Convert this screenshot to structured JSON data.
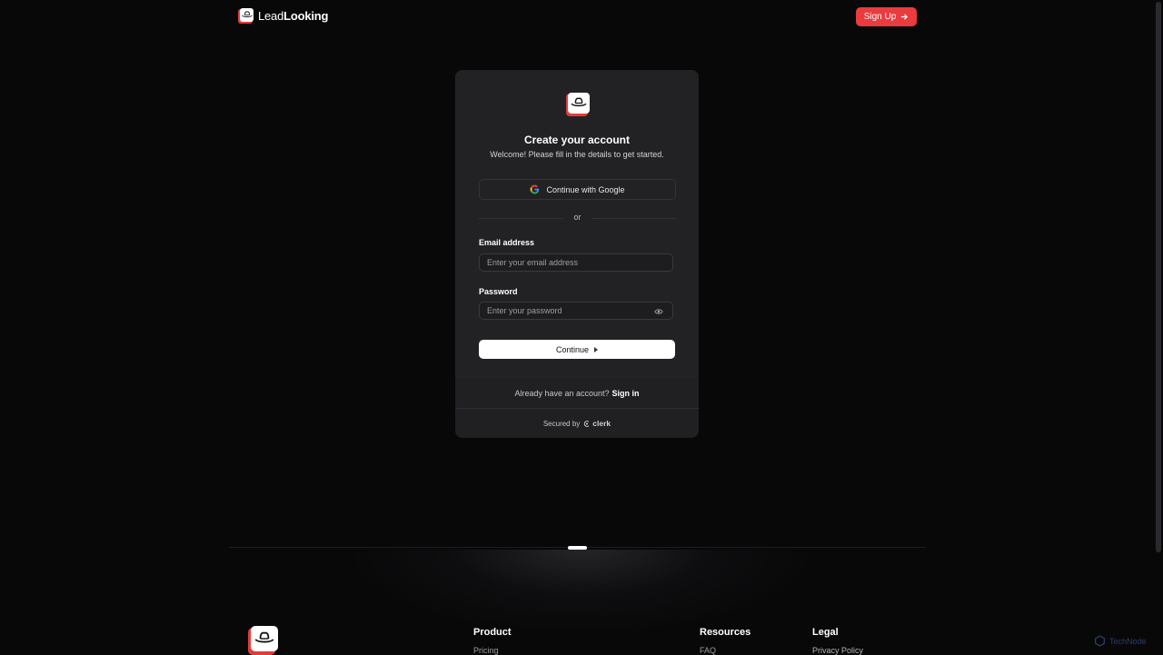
{
  "header": {
    "brand_light": "Lead",
    "brand_bold": "Looking",
    "signup_label": "Sign Up",
    "signup_icon": "arrow-right-icon",
    "accent_color": "#ea3b3e"
  },
  "auth_card": {
    "title": "Create your account",
    "subtitle": "Welcome! Please fill in the details to get started.",
    "google_label": "Continue with Google",
    "divider_text": "or",
    "email_label": "Email address",
    "email_placeholder": "Enter your email address",
    "password_label": "Password",
    "password_placeholder": "Enter your password",
    "continue_label": "Continue",
    "have_account_text": "Already have an account?",
    "signin_label": "Sign in",
    "secured_by_text": "Secured by",
    "clerk_label": "clerk"
  },
  "footer": {
    "columns": [
      {
        "title": "Product",
        "link": "Pricing"
      },
      {
        "title": "Resources",
        "link": "FAQ"
      },
      {
        "title": "Legal",
        "link": "Privacy Policy"
      }
    ]
  },
  "watermark": {
    "label": "TechNode"
  }
}
